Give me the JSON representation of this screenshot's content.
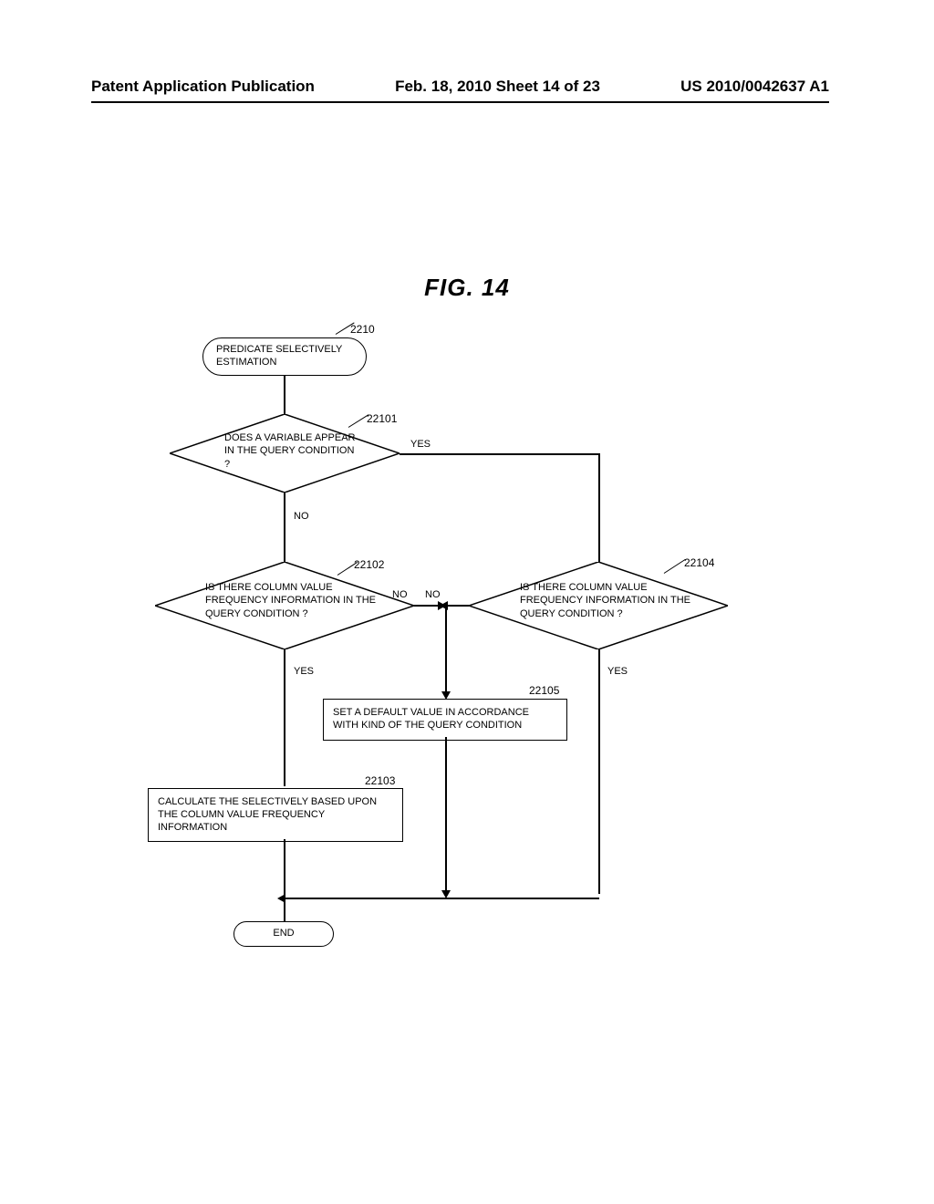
{
  "header": {
    "left": "Patent Application Publication",
    "center": "Feb. 18, 2010  Sheet 14 of 23",
    "right": "US 2010/0042637 A1"
  },
  "figure": {
    "title": "FIG. 14",
    "refs": {
      "2210": "2210",
      "22101": "22101",
      "22102": "22102",
      "22103": "22103",
      "22104": "22104",
      "22105": "22105"
    },
    "nodes": {
      "start": "PREDICATE SELECTIVELY ESTIMATION",
      "d1": "DOES A VARIABLE APPEAR IN THE QUERY CONDITION ?",
      "d2": "IS THERE COLUMN VALUE FREQUENCY INFORMATION IN THE QUERY CONDITION ?",
      "d3": "IS THERE COLUMN VALUE FREQUENCY INFORMATION IN THE QUERY CONDITION ?",
      "p_default": "SET A DEFAULT VALUE IN ACCORDANCE WITH KIND OF THE QUERY CONDITION",
      "p_calc": "CALCULATE THE SELECTIVELY BASED UPON THE COLUMN VALUE FREQUENCY INFORMATION",
      "end": "END"
    },
    "labels": {
      "yes": "YES",
      "no": "NO"
    }
  }
}
